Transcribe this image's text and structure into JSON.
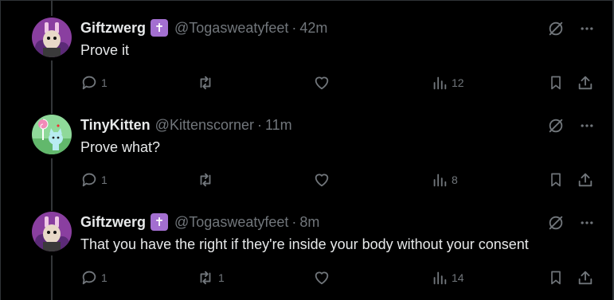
{
  "posts": [
    {
      "name": "Giftzwerg",
      "badge": "✝",
      "handle": "@Togasweatyfeet",
      "time": "42m",
      "text": "Prove it",
      "replies": "1",
      "reposts": "",
      "likes": "",
      "views": "12",
      "avatar_colors": {
        "bg": "#8a3fa0",
        "fg": "#f0c8e6"
      }
    },
    {
      "name": "TinyKitten",
      "badge": "",
      "handle": "@Kittenscorner",
      "time": "11m",
      "text": "Prove what?",
      "replies": "1",
      "reposts": "",
      "likes": "",
      "views": "8",
      "avatar_colors": {
        "bg": "#7fd08a",
        "fg": "#a8e6f0"
      }
    },
    {
      "name": "Giftzwerg",
      "badge": "✝",
      "handle": "@Togasweatyfeet",
      "time": "8m",
      "text": "That you have the right if they're inside your body without your consent",
      "replies": "1",
      "reposts": "1",
      "likes": "",
      "views": "14",
      "avatar_colors": {
        "bg": "#8a3fa0",
        "fg": "#f0c8e6"
      }
    }
  ],
  "separator": "·",
  "icons": {
    "grok": "grok-icon",
    "more": "more-icon",
    "reply": "reply-icon",
    "repost": "repost-icon",
    "like": "like-icon",
    "views": "views-icon",
    "bookmark": "bookmark-icon",
    "share": "share-icon"
  },
  "colors": {
    "background": "#000000",
    "text": "#e7e9ea",
    "muted": "#71767b",
    "badge": "#a36fd0",
    "divider": "#2f3336"
  }
}
